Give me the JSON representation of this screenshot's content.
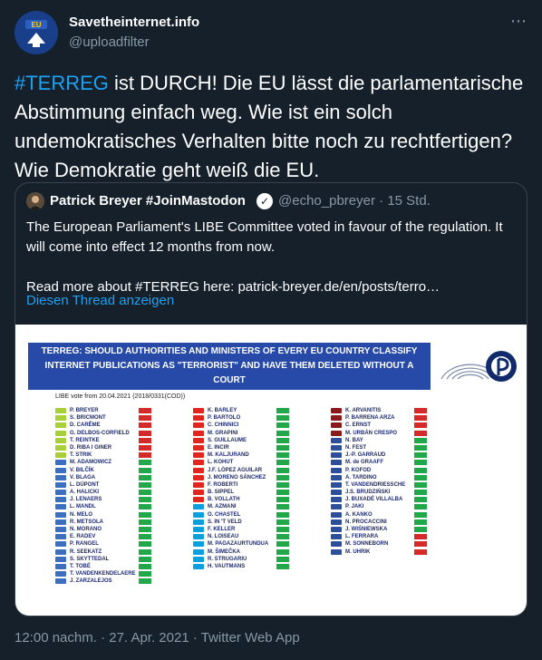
{
  "header": {
    "display_name": "Savetheinternet.info",
    "handle": "@uploadfilter",
    "avatar_text": "EU"
  },
  "tweet": {
    "hashtag": "#TERREG",
    "text": " ist DURCH! Die EU lässt die parlamentarische Abstimmung einfach weg. Wie ist ein solch undemokratisches Verhalten bitte noch zu rechtfertigen? Wie Demokratie geht weiß die EU."
  },
  "quote": {
    "name": "Patrick Breyer #JoinMastodon",
    "handle": "@echo_pbreyer",
    "time": "15 Std.",
    "text_1": "The European Parliament's LIBE Committee voted in favour of the regulation. It will come into effect 12 months from now.",
    "text_2": "Read more about #TERREG here: patrick-breyer.de/en/posts/terro…",
    "thread_link": "Diesen Thread anzeigen"
  },
  "image": {
    "banner_line1": "TERREG: SHOULD AUTHORITIES AND MINISTERS OF EVERY EU COUNTRY        CLASSIFY",
    "banner_line2": "INTERNET PUBLICATIONS AS \"TERRORIST\" AND HAVE THEM DELETED WITHOUT A COURT",
    "banner_line3": "ORDER IN OTHER EU COUNTRIES?",
    "libe_vote": "LIBE vote from 20.04.2021 (2018/0331(COD))",
    "colors": {
      "green_party": "#a6cf38",
      "epp": "#3c6fbf",
      "sd": "#e3261d",
      "renew": "#0aa0e0",
      "ecr": "#2d4e9a",
      "left": "#8b1a1a",
      "yes": "#22a84a",
      "no": "#d42a2a"
    },
    "columns": [
      [
        {
          "name": "P. BREYER",
          "party": "green_party",
          "vote": "no"
        },
        {
          "name": "S. BRICMONT",
          "party": "green_party",
          "vote": "no"
        },
        {
          "name": "D. CARÊME",
          "party": "green_party",
          "vote": "no"
        },
        {
          "name": "G. DELBOS-CORFIELD",
          "party": "green_party",
          "vote": "no"
        },
        {
          "name": "T. REINTKE",
          "party": "green_party",
          "vote": "no"
        },
        {
          "name": "D. RIBA I GINER",
          "party": "green_party",
          "vote": "no"
        },
        {
          "name": "T. STRIK",
          "party": "green_party",
          "vote": "no"
        },
        {
          "name": "M. ADAMOWICZ",
          "party": "epp",
          "vote": "yes"
        },
        {
          "name": "V. BILČÍK",
          "party": "epp",
          "vote": "yes"
        },
        {
          "name": "V. BLAGA",
          "party": "epp",
          "vote": "yes"
        },
        {
          "name": "L. DÜPONT",
          "party": "epp",
          "vote": "yes"
        },
        {
          "name": "A. HALICKI",
          "party": "epp",
          "vote": "yes"
        },
        {
          "name": "J. LENAERS",
          "party": "epp",
          "vote": "yes"
        },
        {
          "name": "L. MANDL",
          "party": "epp",
          "vote": "yes"
        },
        {
          "name": "N. MELO",
          "party": "epp",
          "vote": "yes"
        },
        {
          "name": "R. METSOLA",
          "party": "epp",
          "vote": "yes"
        },
        {
          "name": "N. MORANO",
          "party": "epp",
          "vote": "yes"
        },
        {
          "name": "E. RADEV",
          "party": "epp",
          "vote": "yes"
        },
        {
          "name": "P. RANGEL",
          "party": "epp",
          "vote": "yes"
        },
        {
          "name": "R. SEEKATZ",
          "party": "epp",
          "vote": "yes"
        },
        {
          "name": "S. SKYTTEDAL",
          "party": "epp",
          "vote": "yes"
        },
        {
          "name": "T. TOBÉ",
          "party": "epp",
          "vote": "yes"
        },
        {
          "name": "T. VANDENKENDELAERE",
          "party": "epp",
          "vote": "yes"
        },
        {
          "name": "J. ZARZALEJOS",
          "party": "epp",
          "vote": "yes"
        }
      ],
      [
        {
          "name": "K. BARLEY",
          "party": "sd",
          "vote": "yes"
        },
        {
          "name": "P. BARTOLO",
          "party": "sd",
          "vote": "yes"
        },
        {
          "name": "C. CHINNICI",
          "party": "sd",
          "vote": "yes"
        },
        {
          "name": "M. GRAPINI",
          "party": "sd",
          "vote": "yes"
        },
        {
          "name": "S. GUILLAUME",
          "party": "sd",
          "vote": "yes"
        },
        {
          "name": "E. INCIR",
          "party": "sd",
          "vote": "yes"
        },
        {
          "name": "M. KALJURAND",
          "party": "sd",
          "vote": "yes"
        },
        {
          "name": "L. KOHUT",
          "party": "sd",
          "vote": "yes"
        },
        {
          "name": "J.F. LÓPEZ AGUILAR",
          "party": "sd",
          "vote": "yes"
        },
        {
          "name": "J. MORENO SÁNCHEZ",
          "party": "sd",
          "vote": "yes"
        },
        {
          "name": "F. ROBERTI",
          "party": "sd",
          "vote": "yes"
        },
        {
          "name": "B. SIPPEL",
          "party": "sd",
          "vote": "yes"
        },
        {
          "name": "B. VOLLATH",
          "party": "sd",
          "vote": "yes"
        },
        {
          "name": "M. AZMANI",
          "party": "renew",
          "vote": "yes"
        },
        {
          "name": "O. CHASTEL",
          "party": "renew",
          "vote": "yes"
        },
        {
          "name": "S. IN 'T VELD",
          "party": "renew",
          "vote": "yes"
        },
        {
          "name": "F. KELLER",
          "party": "renew",
          "vote": "yes"
        },
        {
          "name": "N. LOISEAU",
          "party": "renew",
          "vote": "yes"
        },
        {
          "name": "M. PAGAZAURTUNDUA",
          "party": "renew",
          "vote": "yes"
        },
        {
          "name": "M. ŠIMEČKA",
          "party": "renew",
          "vote": "yes"
        },
        {
          "name": "R. STRUGARIU",
          "party": "renew",
          "vote": "yes"
        },
        {
          "name": "H. VAUTMANS",
          "party": "renew",
          "vote": "yes"
        }
      ],
      [
        {
          "name": "K. ARVANITIS",
          "party": "left",
          "vote": "no"
        },
        {
          "name": "P. BARRENA ARZA",
          "party": "left",
          "vote": "no"
        },
        {
          "name": "C. ERNST",
          "party": "left",
          "vote": "no"
        },
        {
          "name": "M. URBÁN CRESPO",
          "party": "left",
          "vote": "no"
        },
        {
          "name": "N. BAY",
          "party": "ecr",
          "vote": "yes"
        },
        {
          "name": "N. FEST",
          "party": "ecr",
          "vote": "yes"
        },
        {
          "name": "J.-P. GARRAUD",
          "party": "ecr",
          "vote": "yes"
        },
        {
          "name": "M. de GRAAFF",
          "party": "ecr",
          "vote": "yes"
        },
        {
          "name": "P. KOFOD",
          "party": "ecr",
          "vote": "yes"
        },
        {
          "name": "A. TARDINO",
          "party": "ecr",
          "vote": "yes"
        },
        {
          "name": "T. VANDENDRIESSCHE",
          "party": "ecr",
          "vote": "yes"
        },
        {
          "name": "J.S. BRUDZIŃSKI",
          "party": "ecr",
          "vote": "yes"
        },
        {
          "name": "J. BUXADÉ VILLALBA",
          "party": "ecr",
          "vote": "yes"
        },
        {
          "name": "P. JAKI",
          "party": "ecr",
          "vote": "yes"
        },
        {
          "name": "A. KANKO",
          "party": "ecr",
          "vote": "yes"
        },
        {
          "name": "N. PROCACCINI",
          "party": "ecr",
          "vote": "yes"
        },
        {
          "name": "J. WIŚNIEWSKA",
          "party": "ecr",
          "vote": "yes"
        },
        {
          "name": "L. FERRARA",
          "party": "ecr",
          "vote": "no"
        },
        {
          "name": "M. SONNEBORN",
          "party": "ecr",
          "vote": "no"
        },
        {
          "name": "M. UHRIK",
          "party": "ecr",
          "vote": "no"
        }
      ]
    ]
  },
  "footer": {
    "time": "12:00 nachm.",
    "separator": " · ",
    "date": "27. Apr. 2021",
    "client": "Twitter Web App"
  }
}
